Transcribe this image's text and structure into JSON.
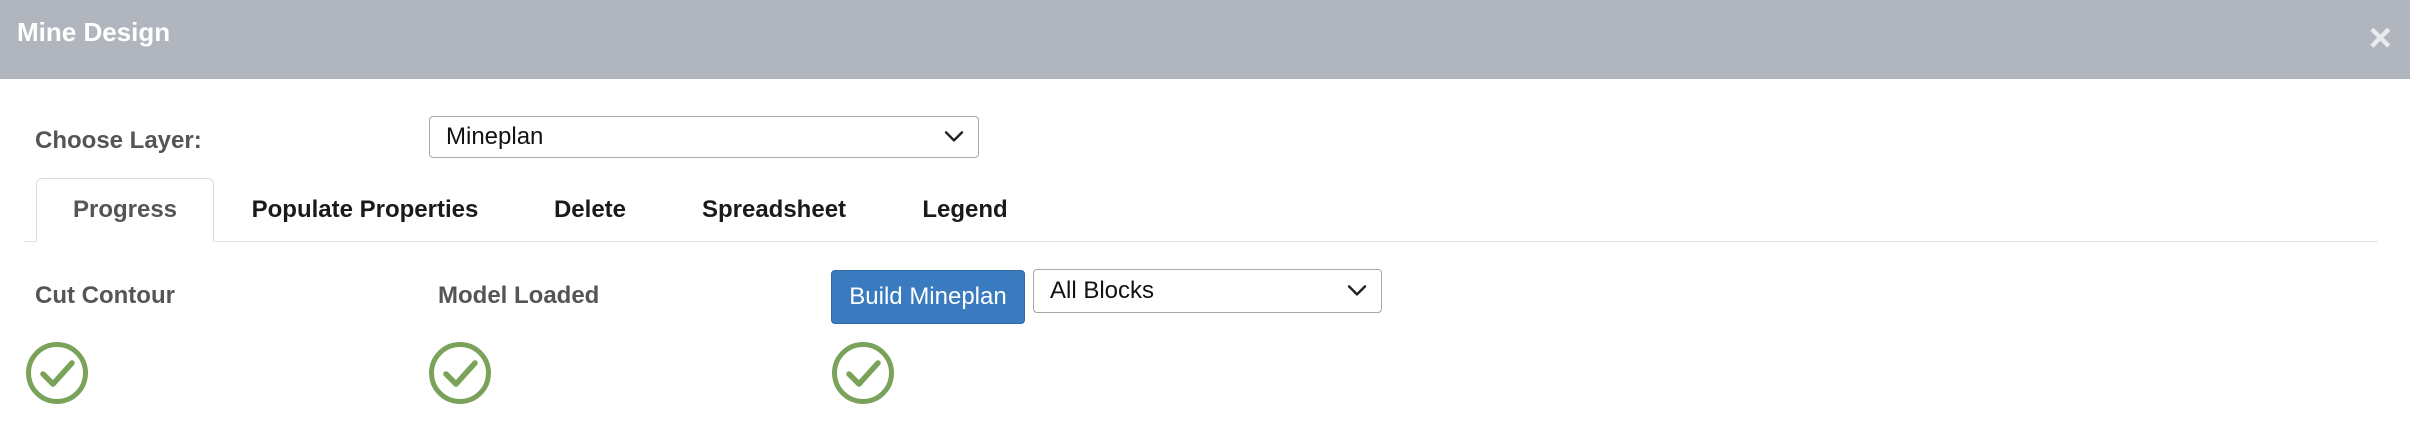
{
  "dialog": {
    "title": "Mine Design",
    "close_glyph": "×"
  },
  "layer": {
    "label": "Choose Layer:",
    "selected": "Mineplan"
  },
  "tabs": [
    {
      "label": "Progress",
      "active": true
    },
    {
      "label": "Populate Properties",
      "active": false
    },
    {
      "label": "Delete",
      "active": false
    },
    {
      "label": "Spreadsheet",
      "active": false
    },
    {
      "label": "Legend",
      "active": false
    }
  ],
  "progress": {
    "steps": [
      {
        "label": "Cut Contour",
        "status": "complete",
        "icon": "check-circle-icon"
      },
      {
        "label": "Model Loaded",
        "status": "complete",
        "icon": "check-circle-icon"
      },
      {
        "label": "Build Mineplan",
        "status": "complete",
        "icon": "check-circle-icon"
      }
    ],
    "build_button_label": "Build Mineplan",
    "blocks_selected": "All Blocks"
  },
  "colors": {
    "header_bg": "#b1b5be",
    "primary_button": "#3a7bbf",
    "check_green": "#7aa25a"
  }
}
